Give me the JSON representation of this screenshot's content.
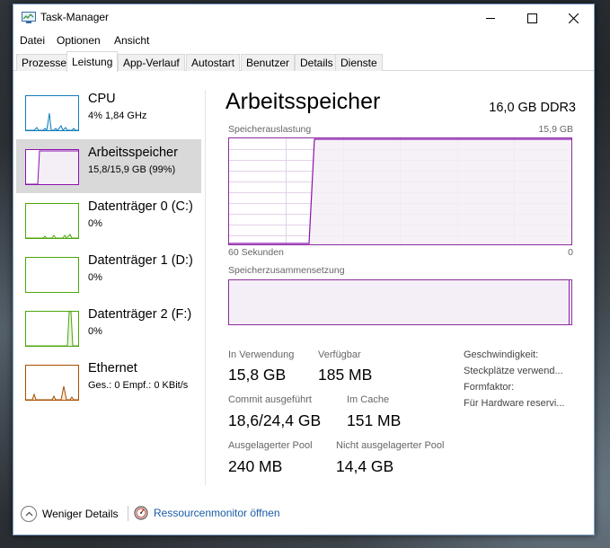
{
  "window": {
    "title": "Task-Manager"
  },
  "menu": [
    "Datei",
    "Optionen",
    "Ansicht"
  ],
  "tabs": [
    "Prozesse",
    "Leistung",
    "App-Verlauf",
    "Autostart",
    "Benutzer",
    "Details",
    "Dienste"
  ],
  "active_tab": "Leistung",
  "sidebar": {
    "items": [
      {
        "title": "CPU",
        "subtitle": "4%  1,84 GHz"
      },
      {
        "title": "Arbeitsspeicher",
        "subtitle": "15,8/15,9 GB (99%)"
      },
      {
        "title": "Datenträger 0 (C:)",
        "subtitle": "0%"
      },
      {
        "title": "Datenträger 1 (D:)",
        "subtitle": "0%"
      },
      {
        "title": "Datenträger 2 (F:)",
        "subtitle": "0%"
      },
      {
        "title": "Ethernet",
        "subtitle": "Ges.: 0  Empf.: 0 KBit/s"
      }
    ],
    "colors": {
      "cpu": "#117dbb",
      "memory": "#8b12ae",
      "disk": "#4da60c",
      "ethernet": "#a74f01"
    }
  },
  "main": {
    "title": "Arbeitsspeicher",
    "spec": "16,0 GB DDR3",
    "usage_graph": {
      "label": "Speicherauslastung",
      "max_label": "15,9 GB",
      "time_label": "60 Sekunden",
      "zero_label": "0"
    },
    "composition_label": "Speicherzusammensetzung",
    "stats": {
      "in_use_label": "In Verwendung",
      "in_use_value": "15,8 GB",
      "available_label": "Verfügbar",
      "available_value": "185 MB",
      "commit_label": "Commit ausgeführt",
      "commit_value": "18,6/24,4 GB",
      "cached_label": "Im Cache",
      "cached_value": "151 MB",
      "paged_label": "Ausgelagerter Pool",
      "paged_value": "240 MB",
      "nonpaged_label": "Nicht ausgelagerter Pool",
      "nonpaged_value": "14,4 GB"
    },
    "details": {
      "speed": "Geschwindigkeit:",
      "slots": "Steckplätze verwend...",
      "form": "Formfaktor:",
      "reserved": "Für Hardware reservi..."
    }
  },
  "footer": {
    "fewer_details": "Weniger Details",
    "resource_monitor": "Ressourcenmonitor öffnen"
  }
}
